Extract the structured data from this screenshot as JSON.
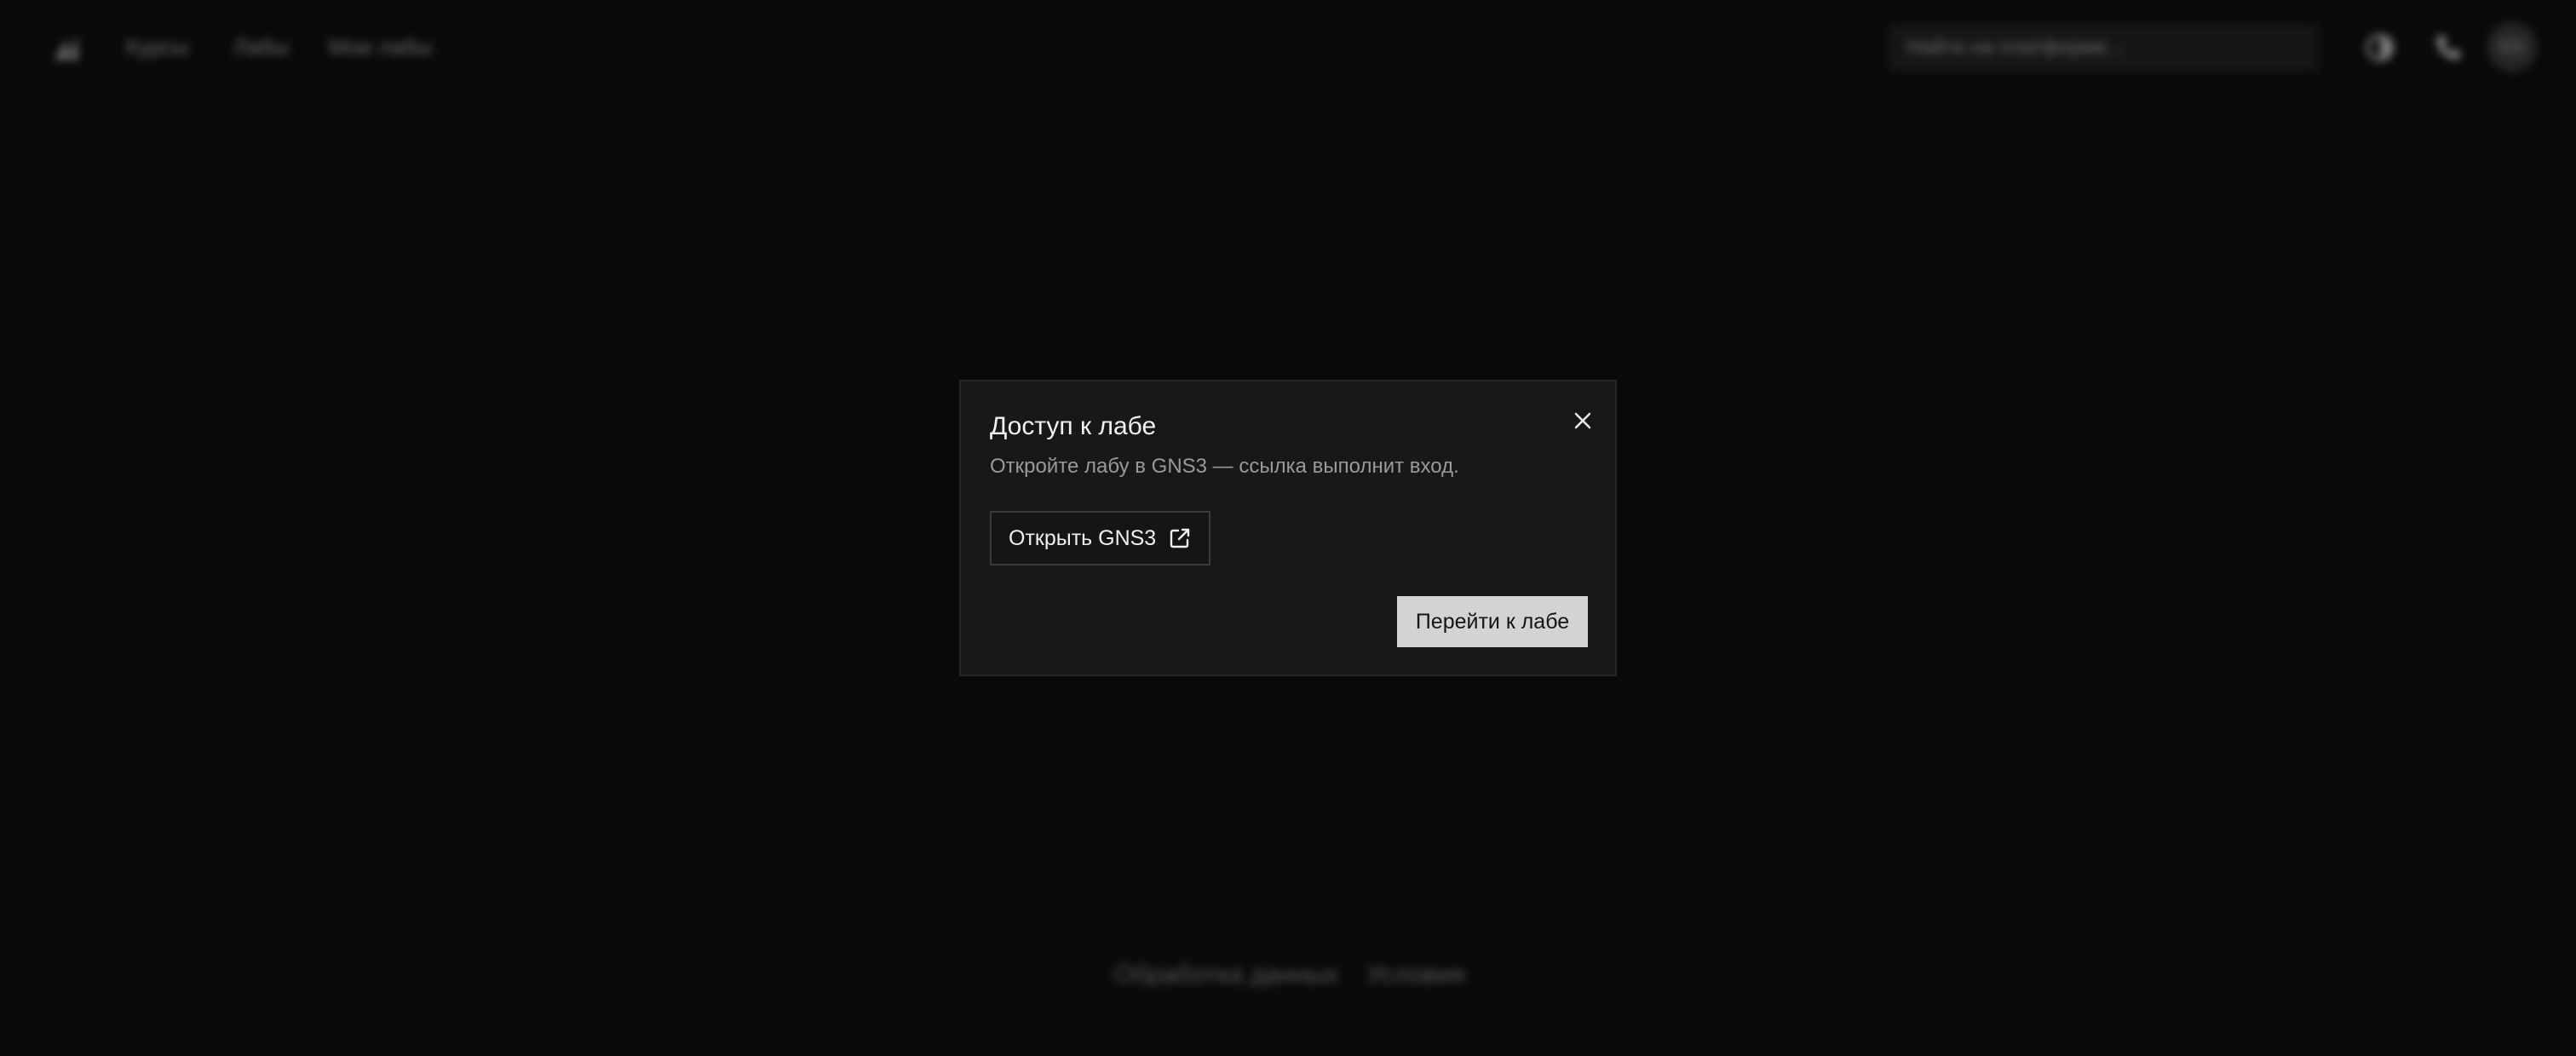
{
  "nav": {
    "items": [
      {
        "label": "Курсы"
      },
      {
        "label": "Лабы"
      },
      {
        "label": "Мои лабы"
      }
    ]
  },
  "search": {
    "placeholder": "Найти на платформе..."
  },
  "user": {
    "avatar_initials": "ЕБ"
  },
  "footer": {
    "links": [
      {
        "label": "Обработка данных"
      },
      {
        "label": "Условия"
      }
    ]
  },
  "dialog": {
    "title": "Доступ к лабе",
    "description": "Откройте лабу в GNS3 — ссылка выполнит вход.",
    "open_button_label": "Открыть GNS3",
    "go_button_label": "Перейти к лабе",
    "close_icon": "close-icon",
    "external_icon": "external-link-icon"
  },
  "colors": {
    "background": "#0a0a0a",
    "dialog_background": "#181818",
    "primary_button": "#d3d3d3"
  }
}
